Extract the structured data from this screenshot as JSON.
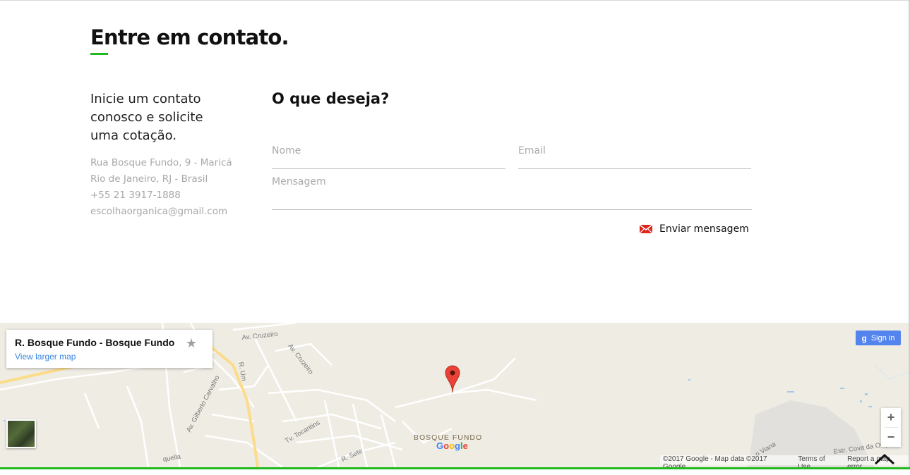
{
  "contact": {
    "title": "Entre em contato.",
    "intro": "Inicie um contato conosco e solicite uma cotação.",
    "address_line1": "Rua Bosque Fundo, 9 - Maricá",
    "address_line2": "Rio de Janeiro, RJ - Brasil",
    "phone": "+55 21 3917-1888",
    "email": "escolhaorganica@gmail.com"
  },
  "form": {
    "title": "O que deseja?",
    "name_placeholder": "Nome",
    "email_placeholder": "Email",
    "message_placeholder": "Mensagem",
    "send_label": "Enviar mensagem",
    "send_icon": "envelope-icon"
  },
  "map": {
    "place_title": "R. Bosque Fundo - Bosque Fundo",
    "larger_map_link": "View larger map",
    "sign_in_label": "Sign in",
    "neighborhood_label": "BOSQUE FUNDO",
    "google_logo": "Google",
    "zoom_in": "+",
    "zoom_out": "−",
    "attribution_text": "©2017 Google - Map data ©2017 Google",
    "terms_link": "Terms of Use",
    "report_link": "Report a map error",
    "street_labels": [
      "Av. Cruzeiro",
      "Av. Cruzeiro",
      "R. Um",
      "Av. Gilberto Carvalho",
      "Tv. Tocantins",
      "R. Sete",
      "quella",
      "o Viana",
      "Estr. Cova da Onça"
    ]
  },
  "colors": {
    "accent": "#1fba1f",
    "envelope": "#e0251b",
    "map_bg": "#efece4",
    "sign_in": "#5383ec"
  }
}
